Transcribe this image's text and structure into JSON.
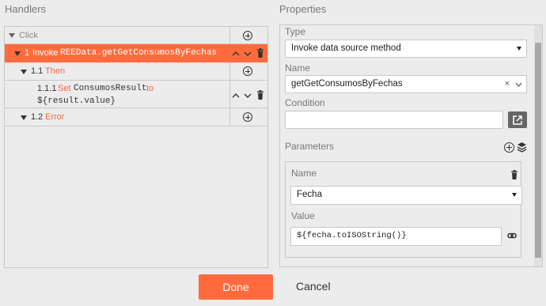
{
  "handlers": {
    "title": "Handlers",
    "rows": [
      {
        "number": "",
        "prefix": "Click",
        "code": ""
      },
      {
        "number": "1",
        "prefix": "Invoke",
        "code": "REEData.getGetConsumosByFechas"
      },
      {
        "number": "1.1",
        "prefix": "Then",
        "code": ""
      },
      {
        "number": "1.1.1",
        "prefix": "Set",
        "code": "ConsumosResult",
        "suffix": "to",
        "code2": "${result.value}"
      },
      {
        "number": "1.2",
        "prefix": "Error",
        "code": ""
      }
    ]
  },
  "properties": {
    "title": "Properties",
    "type_label": "Type",
    "type_value": "Invoke data source method",
    "name_label": "Name",
    "name_value": "getGetConsumosByFechas",
    "clear_symbol": "×",
    "condition_label": "Condition",
    "condition_value": "",
    "parameters_label": "Parameters",
    "param": {
      "name_label": "Name",
      "name_value": "Fecha",
      "value_label": "Value",
      "value_value": "${fecha.toISOString()}"
    }
  },
  "footer": {
    "done_label": "Done",
    "cancel_label": "Cancel"
  },
  "colors": {
    "accent": "#ff6b3d",
    "keyword": "#f26b3f"
  }
}
